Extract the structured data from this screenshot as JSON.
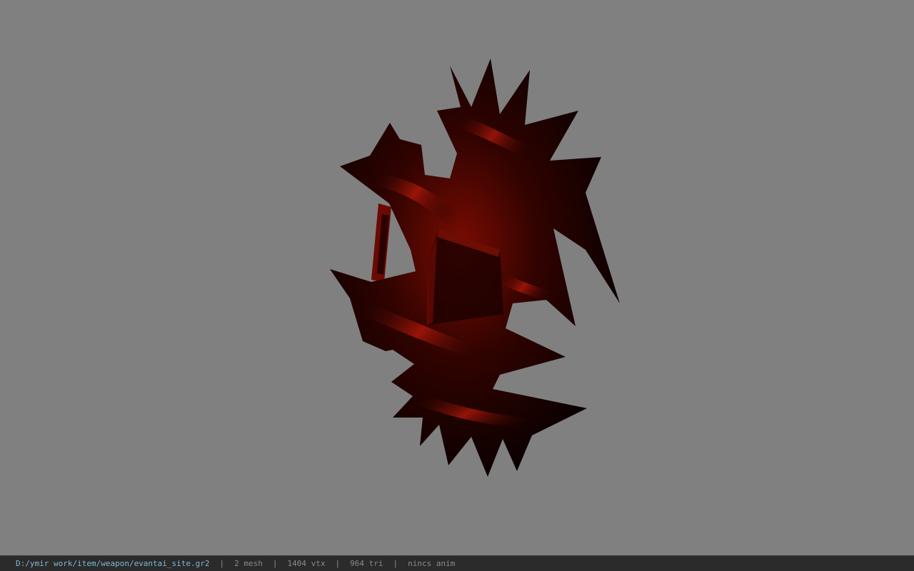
{
  "viewport": {
    "background": "#808080",
    "model_name": "evantai_site",
    "model_colors": {
      "dark": "#000000",
      "mid": "#3a0500",
      "highlight": "#a01404"
    }
  },
  "statusbar": {
    "path": "D:/ymir work/item/weapon/evantai_site.gr2",
    "mesh": "2 mesh",
    "vertices": "1404 vtx",
    "triangles": "964 tri",
    "anim": "nincs anim",
    "separator": "|"
  }
}
